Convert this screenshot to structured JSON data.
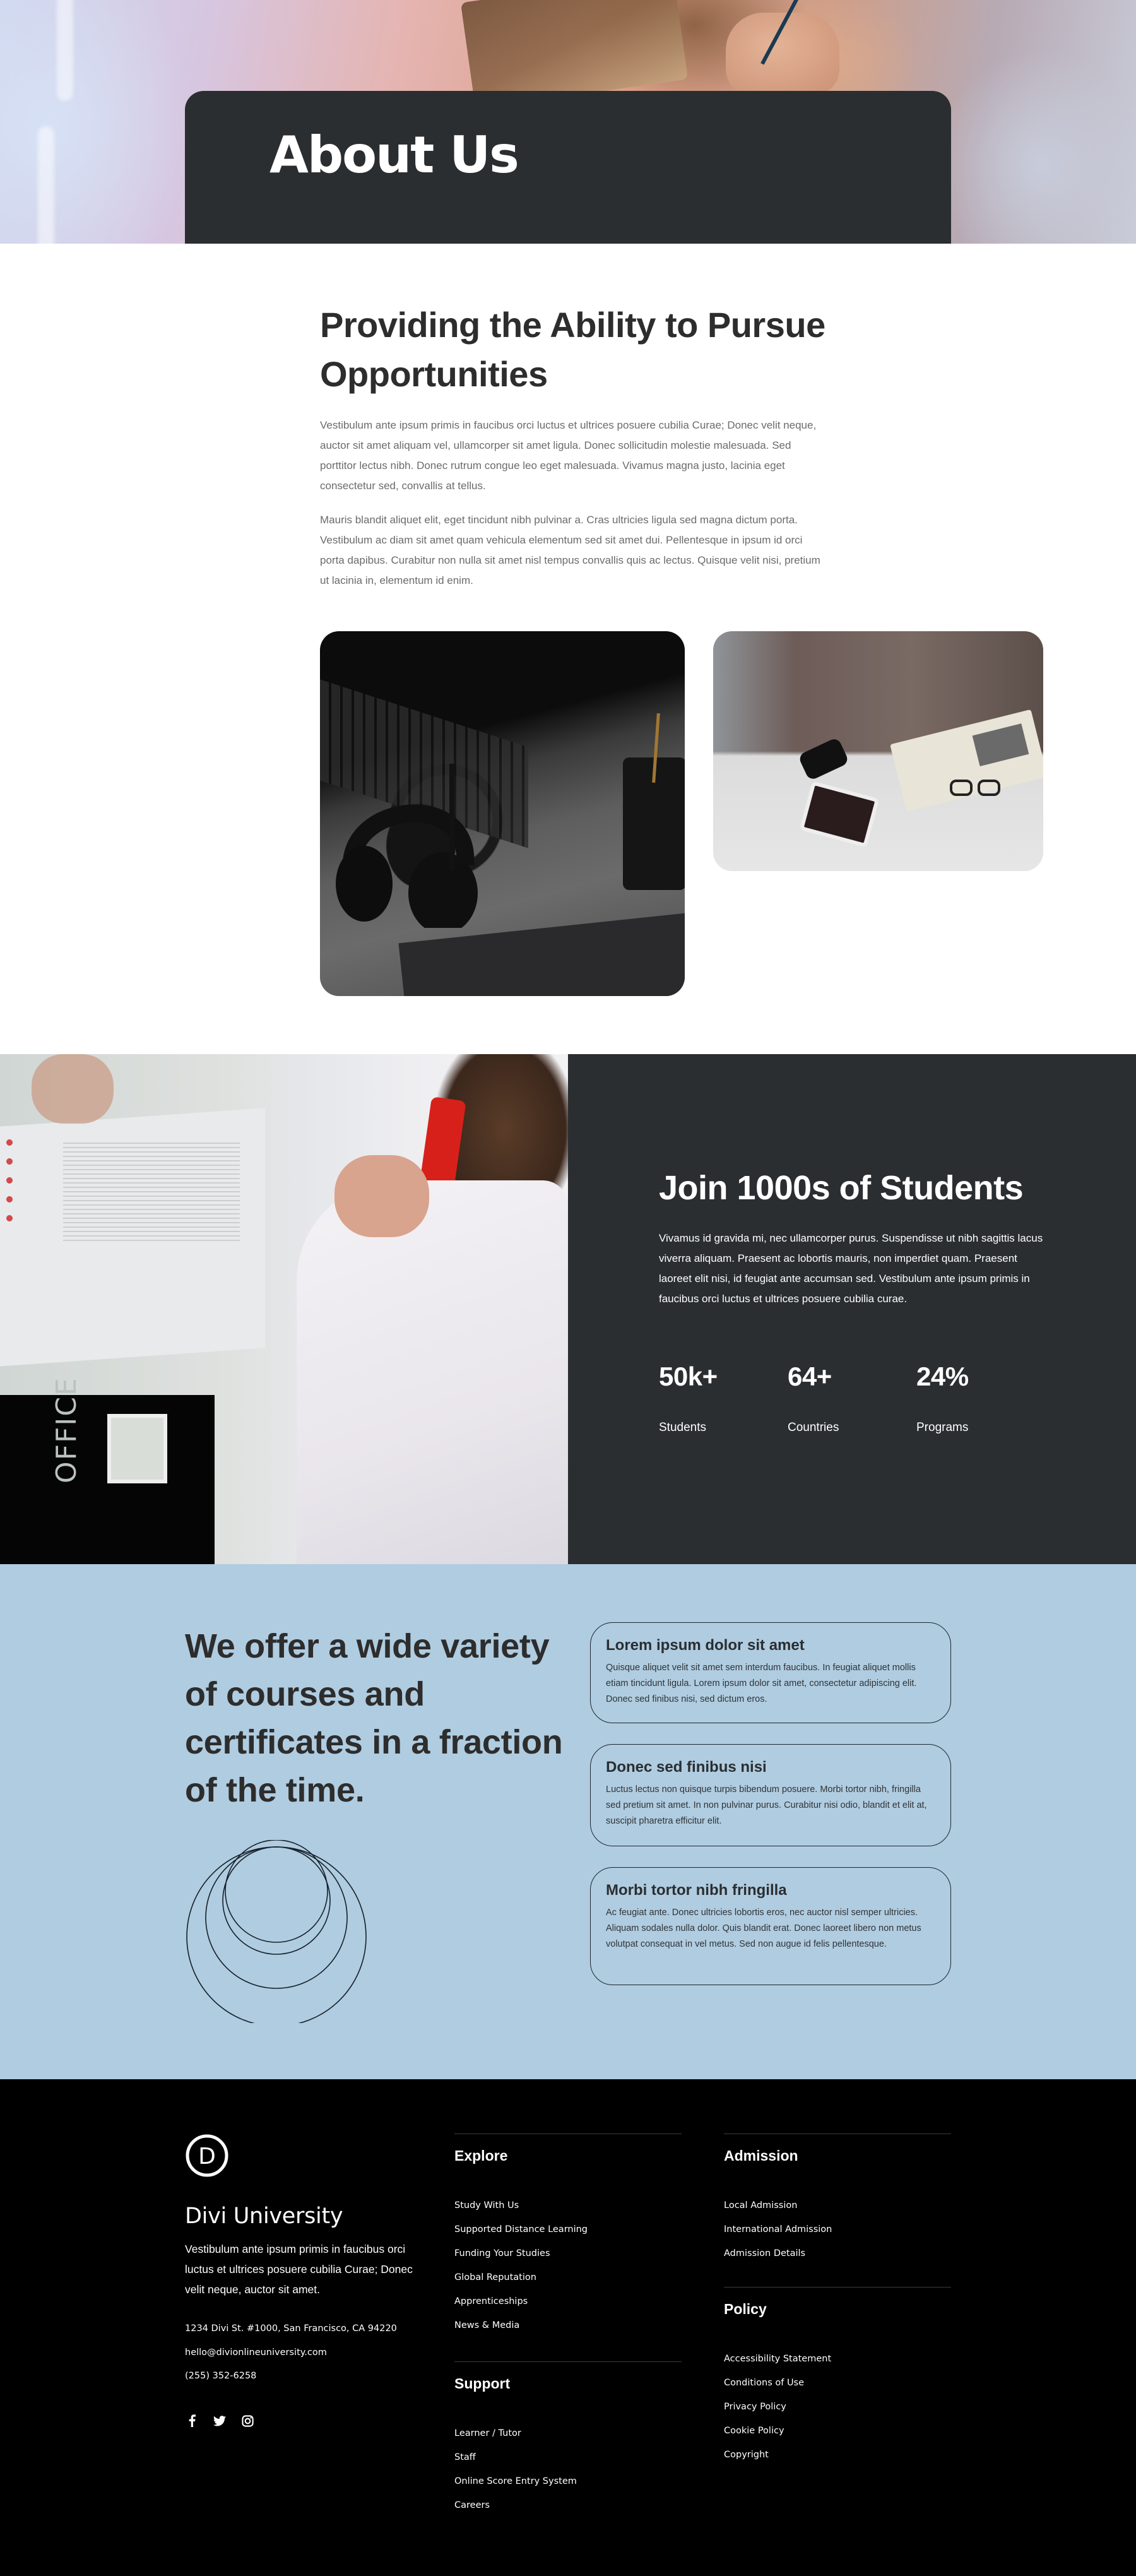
{
  "hero": {
    "title": "About Us"
  },
  "intro": {
    "heading": "Providing the Ability to Pursue Opportunities",
    "paragraphs": [
      "Vestibulum ante ipsum primis in faucibus orci luctus et ultrices posuere cubilia Curae; Donec velit neque, auctor sit amet aliquam vel, ullamcorper sit amet ligula. Donec sollicitudin molestie malesuada. Sed porttitor lectus nibh. Donec rutrum congue leo eget malesuada. Vivamus magna justo, lacinia eget consectetur sed, convallis at tellus.",
      "Mauris blandit aliquet elit, eget tincidunt nibh pulvinar a. Cras ultricies ligula sed magna dictum porta. Vestibulum ac diam sit amet quam vehicula elementum sed sit amet dui. Pellentesque in ipsum id orci porta dapibus. Curabitur non nulla sit amet nisl tempus convallis quis ac lectus. Quisque velit nisi, pretium ut lacinia in, elementum id enim."
    ],
    "images": [
      {
        "name": "desk-headphones-photo",
        "description": "Headphones, laptop keyboard and pencil cup on a dark desk"
      },
      {
        "name": "desk-tablet-photo",
        "description": "Tablet, glasses and open book on a white table"
      }
    ]
  },
  "students": {
    "image": {
      "name": "student-writing-photo",
      "description": "Student in white shirt writing in a notebook"
    },
    "heading": "Join 1000s of Students",
    "paragraph": "Vivamus id gravida mi, nec ullamcorper purus. Suspendisse ut nibh sagittis lacus viverra aliquam. Praesent ac lobortis mauris, non imperdiet quam. Praesent laoreet elit nisi, id feugiat ante accumsan sed. Vestibulum ante ipsum primis in faucibus orci luctus et ultrices posuere cubilia curae.",
    "stats": [
      {
        "value": "50k+",
        "label": "Students"
      },
      {
        "value": "64+",
        "label": "Countries"
      },
      {
        "value": "24%",
        "label": "Programs"
      }
    ]
  },
  "courses": {
    "heading": "We offer a wide variety of courses and certificates in a fraction of the time.",
    "decoration": "concentric-circles-graphic",
    "cards": [
      {
        "title": "Lorem ipsum dolor sit amet",
        "body": "Quisque aliquet velit sit amet sem interdum faucibus. In feugiat aliquet mollis etiam tincidunt ligula. Lorem ipsum dolor sit amet, consectetur adipiscing elit. Donec sed finibus nisi, sed dictum eros."
      },
      {
        "title": "Donec sed finibus nisi",
        "body": "Luctus lectus non quisque turpis bibendum posuere. Morbi tortor nibh, fringilla sed pretium sit amet. In non pulvinar purus. Curabitur nisi odio, blandit et elit at, suscipit pharetra efficitur elit."
      },
      {
        "title": "Morbi tortor nibh fringilla",
        "body": "Ac feugiat ante. Donec ultricies lobortis eros, nec auctor nisl semper ultricies. Aliquam sodales nulla dolor. Quis blandit erat. Donec laoreet libero non metus volutpat consequat in vel metus. Sed non augue id felis pellentesque."
      }
    ]
  },
  "footer": {
    "logo_letter": "D",
    "brand": "Divi University",
    "description": "Vestibulum ante ipsum primis in faucibus orci luctus et ultrices posuere cubilia Curae; Donec velit neque, auctor sit amet.",
    "address": "1234 Divi St. #1000, San Francisco, CA 94220",
    "email": "hello@divionlineuniversity.com",
    "phone": "(255) 352-6258",
    "social": [
      {
        "name": "facebook-icon",
        "glyph": "f"
      },
      {
        "name": "twitter-icon",
        "glyph": "t"
      },
      {
        "name": "instagram-icon",
        "glyph": "i"
      }
    ],
    "explore": {
      "title": "Explore",
      "links": [
        "Study With Us",
        "Supported Distance Learning",
        "Funding Your Studies",
        "Global Reputation",
        "Apprenticeships",
        "News & Media"
      ]
    },
    "support": {
      "title": "Support",
      "links": [
        "Learner / Tutor",
        "Staff",
        "Online Score Entry System",
        "Careers"
      ]
    },
    "admission": {
      "title": "Admission",
      "links": [
        "Local Admission",
        "International Admission",
        "Admission Details"
      ]
    },
    "policy": {
      "title": "Policy",
      "links": [
        "Accessibility Statement",
        "Conditions of Use",
        "Privacy Policy",
        "Cookie Policy",
        "Copyright"
      ]
    }
  },
  "colors": {
    "dark_panel": "#2a2e31",
    "courses_bg": "#b0cce0",
    "footer_bg": "#000000",
    "heading_text": "#2d2d2d",
    "body_text": "#6b6b6b"
  }
}
